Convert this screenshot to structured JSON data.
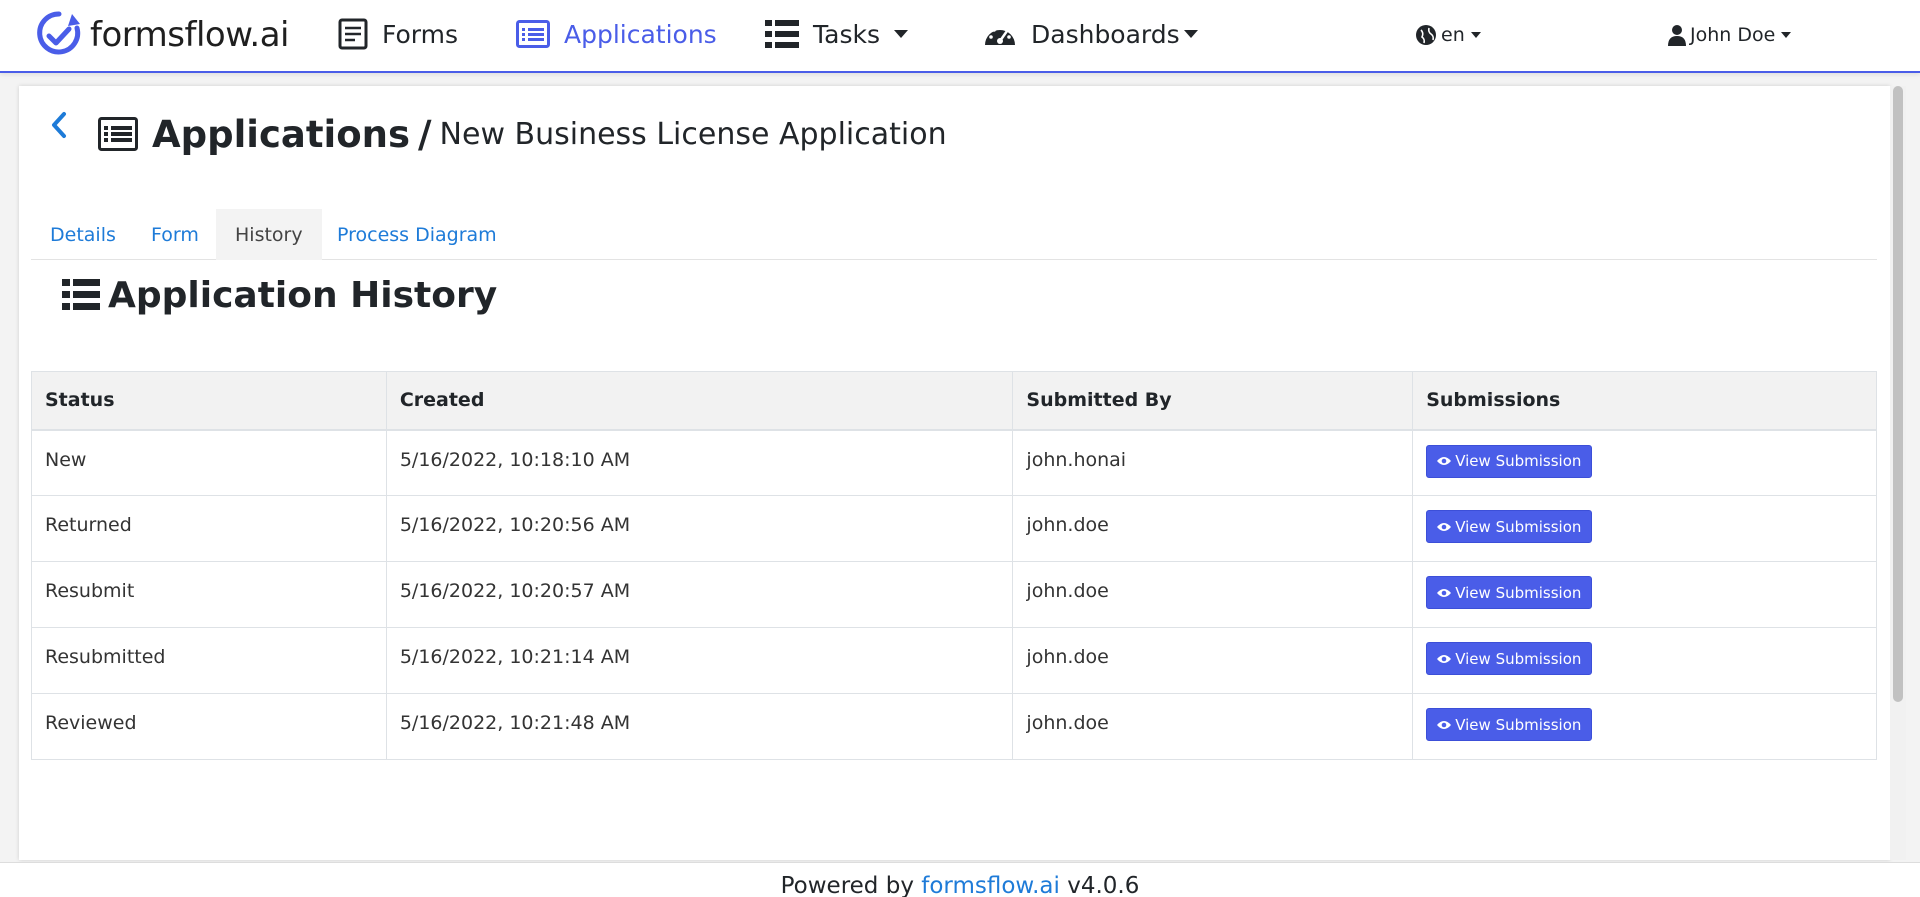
{
  "navbar": {
    "brand": "formsflow.ai",
    "items": [
      {
        "label": "Forms",
        "icon": "form-icon"
      },
      {
        "label": "Applications",
        "icon": "list-icon",
        "active": true
      },
      {
        "label": "Tasks",
        "icon": "tasks-icon",
        "dropdown": true
      },
      {
        "label": "Dashboards",
        "icon": "dashboard-icon",
        "dropdown": true
      }
    ],
    "language": "en",
    "user": "John Doe",
    "accent_color": "#4a5de8"
  },
  "page": {
    "title": "Applications",
    "separator": "/",
    "subtitle": "New Business License Application"
  },
  "tabs": [
    {
      "label": "Details"
    },
    {
      "label": "Form"
    },
    {
      "label": "History",
      "active": true
    },
    {
      "label": "Process Diagram"
    }
  ],
  "section": {
    "title": "Application History"
  },
  "table": {
    "headers": [
      "Status",
      "Created",
      "Submitted By",
      "Submissions"
    ],
    "rows": [
      {
        "status": "New",
        "created": "5/16/2022, 10:18:10 AM",
        "submitted_by": "john.honai",
        "action": "View Submission"
      },
      {
        "status": "Returned",
        "created": "5/16/2022, 10:20:56 AM",
        "submitted_by": "john.doe",
        "action": "View Submission"
      },
      {
        "status": "Resubmit",
        "created": "5/16/2022, 10:20:57 AM",
        "submitted_by": "john.doe",
        "action": "View Submission"
      },
      {
        "status": "Resubmitted",
        "created": "5/16/2022, 10:21:14 AM",
        "submitted_by": "john.doe",
        "action": "View Submission"
      },
      {
        "status": "Reviewed",
        "created": "5/16/2022, 10:21:48 AM",
        "submitted_by": "john.doe",
        "action": "View Submission"
      }
    ]
  },
  "footer": {
    "prefix": "Powered by ",
    "link": "formsflow.ai",
    "version": " v4.0.6"
  }
}
